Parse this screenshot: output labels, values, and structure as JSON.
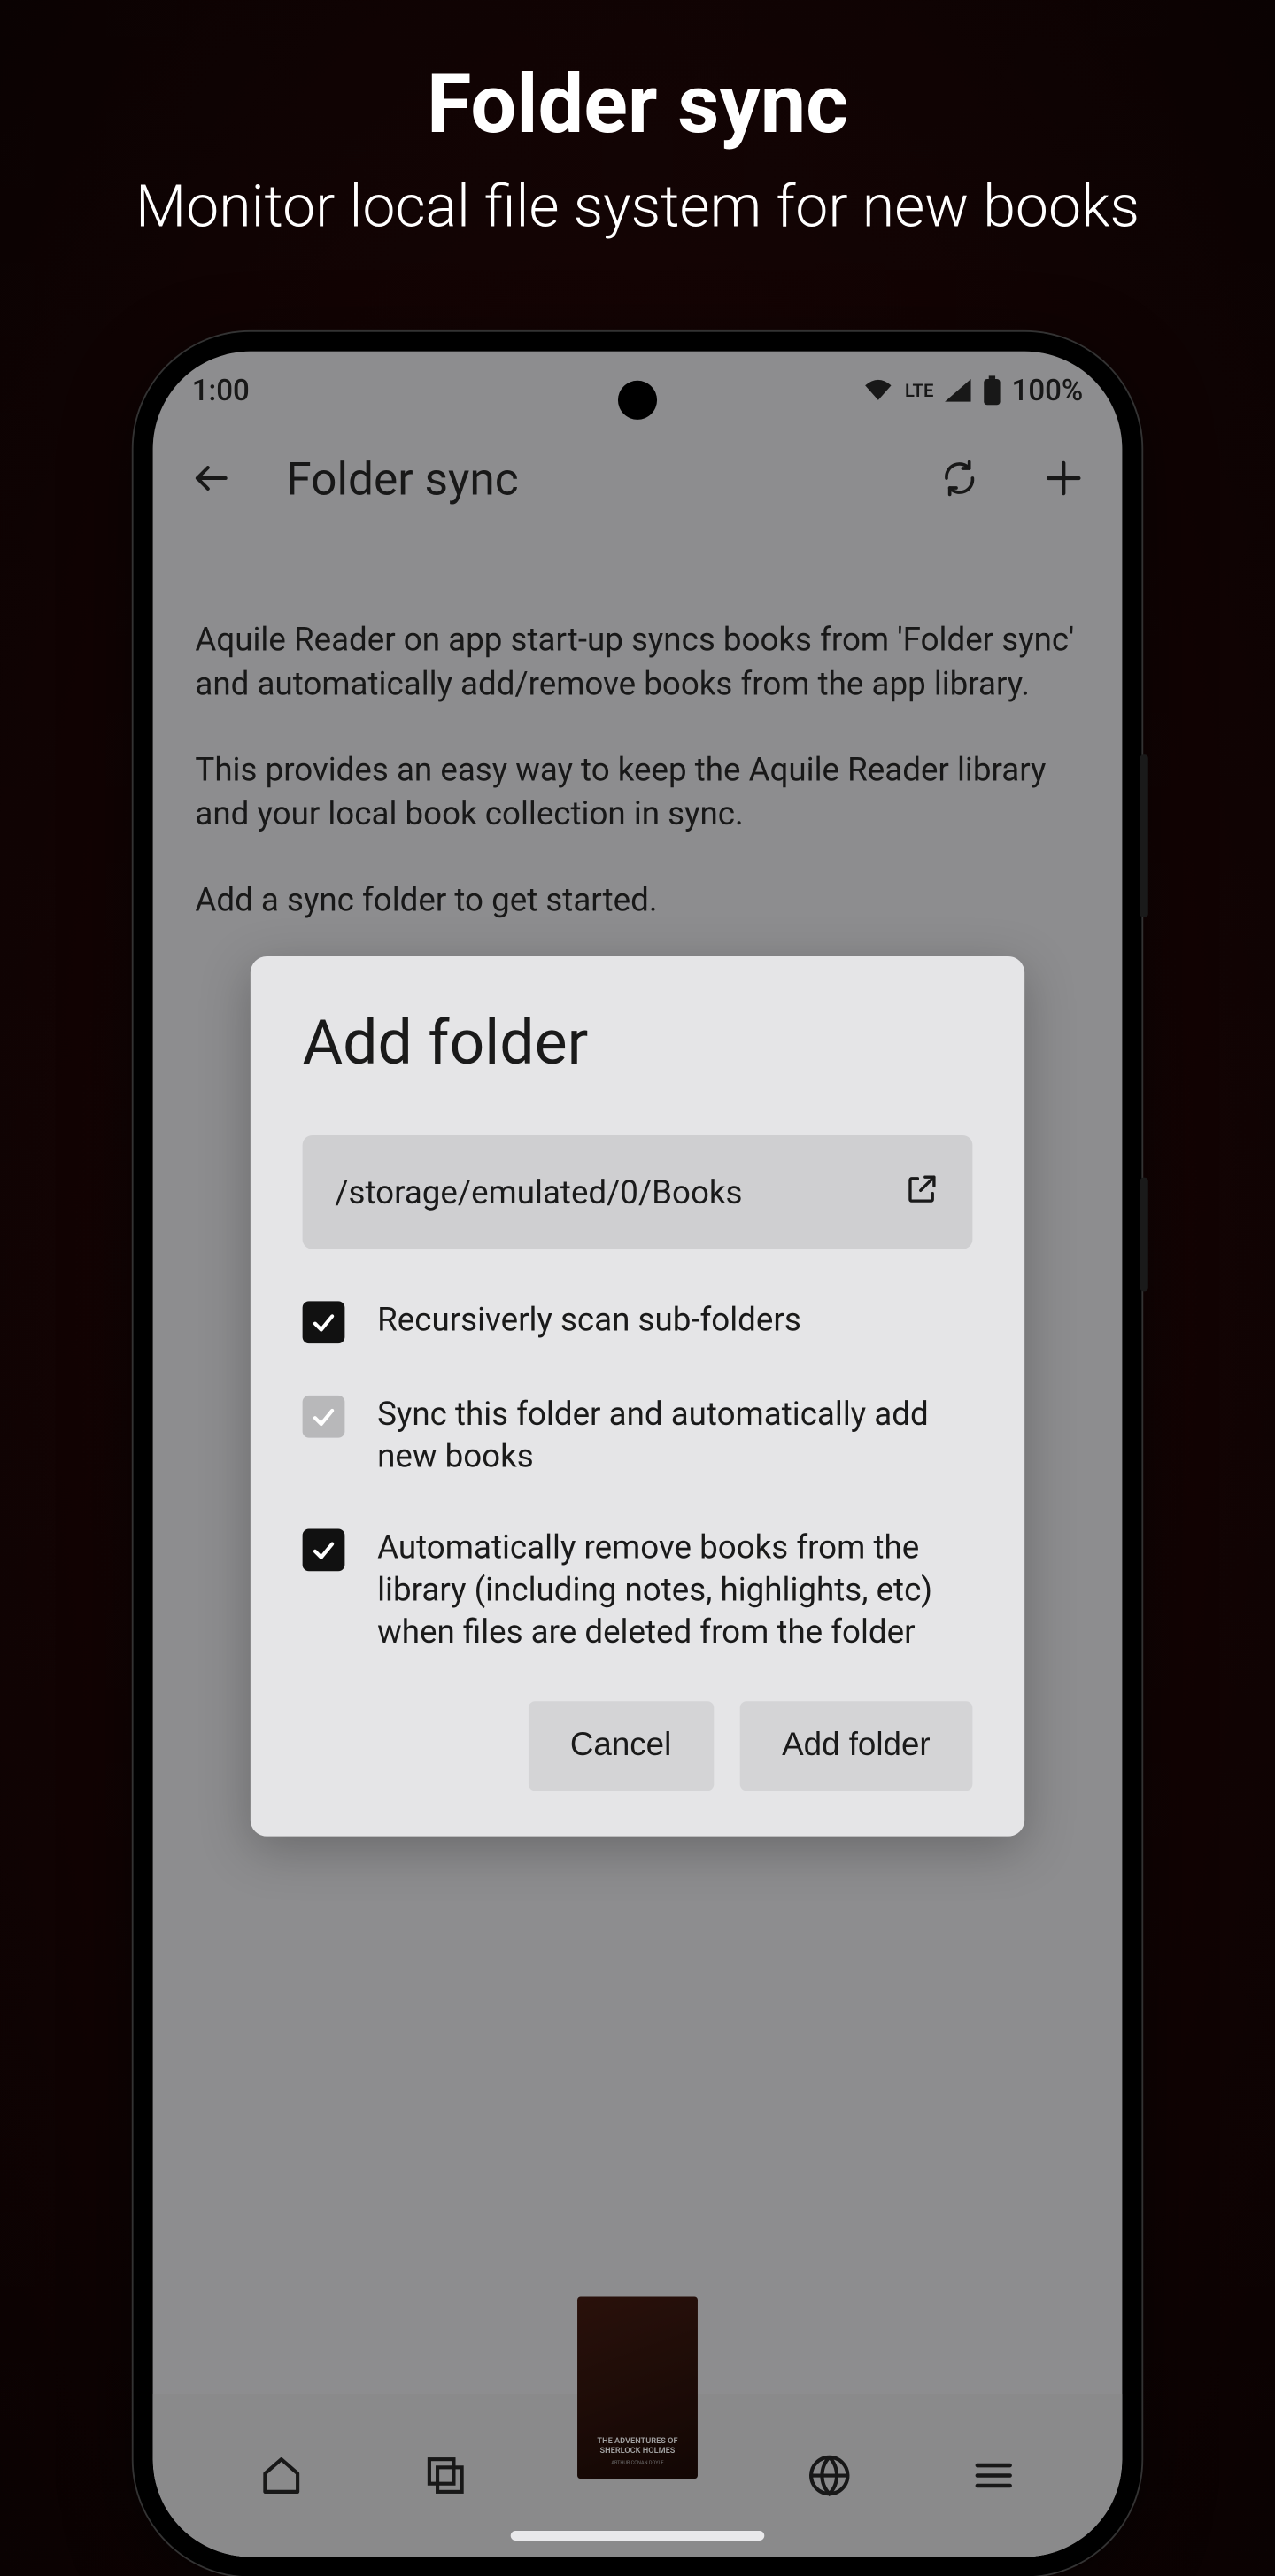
{
  "promo": {
    "title": "Folder sync",
    "subtitle": "Monitor local file system for new books"
  },
  "status": {
    "time": "1:00",
    "net": "LTE",
    "battery": "100%"
  },
  "header": {
    "title": "Folder sync"
  },
  "body": {
    "p1": "Aquile Reader on app start-up syncs books from 'Folder sync' and automatically add/remove books from the app library.",
    "p2": "This provides an easy way to keep the Aquile Reader library and your local book collection in sync.",
    "p3": "Add a sync folder to get started."
  },
  "dialog": {
    "title": "Add folder",
    "path": "/storage/emulated/0/Books",
    "options": {
      "recursive": "Recursiverly scan sub-folders",
      "sync_add": "Sync this folder and automatically add new books",
      "auto_remove": "Automatically remove books from the library (including notes, highlights, etc) when files are deleted from the folder"
    },
    "cancel": "Cancel",
    "confirm": "Add folder"
  },
  "book": {
    "title": "THE ADVENTURES OF SHERLOCK HOLMES",
    "author": "ARTHUR CONAN DOYLE"
  }
}
